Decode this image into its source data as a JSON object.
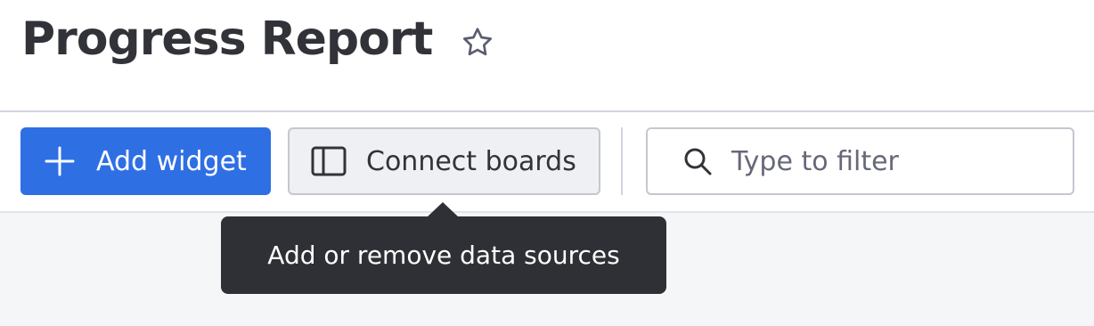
{
  "page": {
    "title": "Progress Report",
    "favorite_icon": "star-outline-icon"
  },
  "toolbar": {
    "add_widget_label": "Add widget",
    "add_widget_icon": "plus-icon",
    "connect_boards_label": "Connect boards",
    "connect_boards_icon": "board-panel-icon",
    "search": {
      "placeholder": "Type to filter",
      "value": "",
      "icon": "search-icon"
    }
  },
  "tooltip": {
    "text": "Add or remove data sources"
  },
  "colors": {
    "primary": "#2f6fe4",
    "tooltip_bg": "#2f3035",
    "text": "#323338",
    "content_bg": "#f5f6f8"
  }
}
